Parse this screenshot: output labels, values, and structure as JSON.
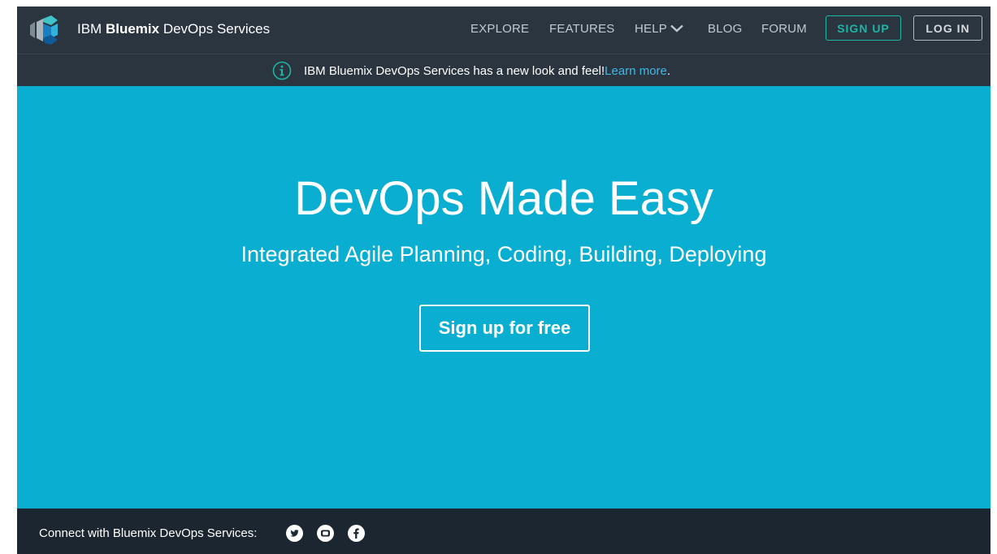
{
  "header": {
    "brand_prefix": "IBM ",
    "brand_bold": "Bluemix",
    "brand_suffix": " DevOps Services",
    "nav": {
      "explore": "EXPLORE",
      "features": "FEATURES",
      "help": "HELP",
      "blog": "BLOG",
      "forum": "FORUM"
    },
    "signup_label": "SIGN UP",
    "login_label": "LOG IN"
  },
  "notice": {
    "text": "IBM Bluemix DevOps Services has a new look and feel! ",
    "link_text": "Learn more",
    "end": "."
  },
  "hero": {
    "title": "DevOps Made Easy",
    "subtitle": "Integrated Agile Planning, Coding, Building, Deploying",
    "cta_label": "Sign up for free"
  },
  "footer": {
    "connect_text": "Connect with Bluemix DevOps Services:",
    "social": [
      "twitter-icon",
      "youtube-icon",
      "facebook-icon"
    ]
  },
  "colors": {
    "nav_bg": "#2a3540",
    "hero_bg": "#0aaed0",
    "footer_bg": "#1c2630",
    "accent_teal": "#1db5a4",
    "link_blue": "#3fb8e6"
  }
}
